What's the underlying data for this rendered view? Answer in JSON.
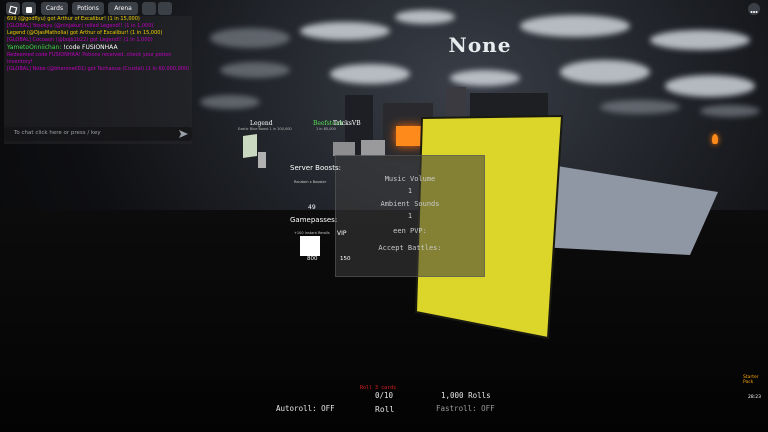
{
  "topbar": {
    "cards_label": "Cards",
    "potions_label": "Potions",
    "arena_label": "Arena"
  },
  "chat": {
    "lines": [
      {
        "text": "699 (@godflyu) got Arthur of Excalibur! (1 in 15,000)",
        "color": "#f0d000"
      },
      {
        "text": "[GLOBAL] Yosokyu (@ninjakur) rolled Legend!! (1 in 1,000)",
        "color": "#c000c0"
      },
      {
        "text": "Legend (@OjasMatholia) got Arthur of Excalibur! (1 in 15,000)",
        "color": "#f0d000"
      },
      {
        "text": "[GLOBAL] Cocoaon (@bojb1b22) got Legend!! (1 in 1,000)",
        "color": "#c000c0"
      },
      {
        "text": "YametoOnniichan: !code FUSIONHAA",
        "color": "#ffffff",
        "name": "YametoOnniichan:",
        "name_color": "#43d84a"
      },
      {
        "text": "Redeemed code FUSIONHAA! Potions received, check your potion inventory!",
        "color": "#c000c0"
      },
      {
        "text": "[GLOBAL] Nobe (@bheroneil01) got Techaoua (Crustal) (1 in 60,000,000)",
        "color": "#c000c0"
      }
    ],
    "input_placeholder": "To chat click here or press / key"
  },
  "scene_title": "None",
  "nametags": {
    "left_name": "Legend",
    "left_sub": "Exotic Blue Boost 1 in 200,000",
    "mid_name": "Beefsteak",
    "mid_name2": "TricksVB",
    "mid_sub": "1 in 85,000"
  },
  "settings_panel": {
    "music_label": "Music Volume",
    "music_value": "1",
    "ambient_label": "Ambient Sounds",
    "ambient_value": "1",
    "pvp_label": "een PVP:",
    "battles_label": "Accept Battles:"
  },
  "boosts": {
    "server_boosts_label": "Server Boosts:",
    "booster_caption": "Random x Booster",
    "booster_value": "49",
    "gamepasses_label": "Gamepasses:",
    "pass_caption": "+100 Instant Rerolls",
    "pass_value": "800",
    "vip_label": "VIP",
    "vip_value": "150"
  },
  "bottom": {
    "roll_notice": "Roll 3 cards",
    "autoroll_label": "Autoroll: OFF",
    "roll_count": "0/10",
    "roll_label": "Roll",
    "rolls_total": "1,000 Rolls",
    "fastroll_label": "Fastroll: OFF"
  },
  "side": {
    "starter_pack": "Starter Pack",
    "timer": "28:23"
  },
  "colors": {
    "yellow_card": "#dcd62a",
    "lava": "#ff8a1c",
    "roll_notice": "#e02020",
    "starter": "#ffa500"
  }
}
